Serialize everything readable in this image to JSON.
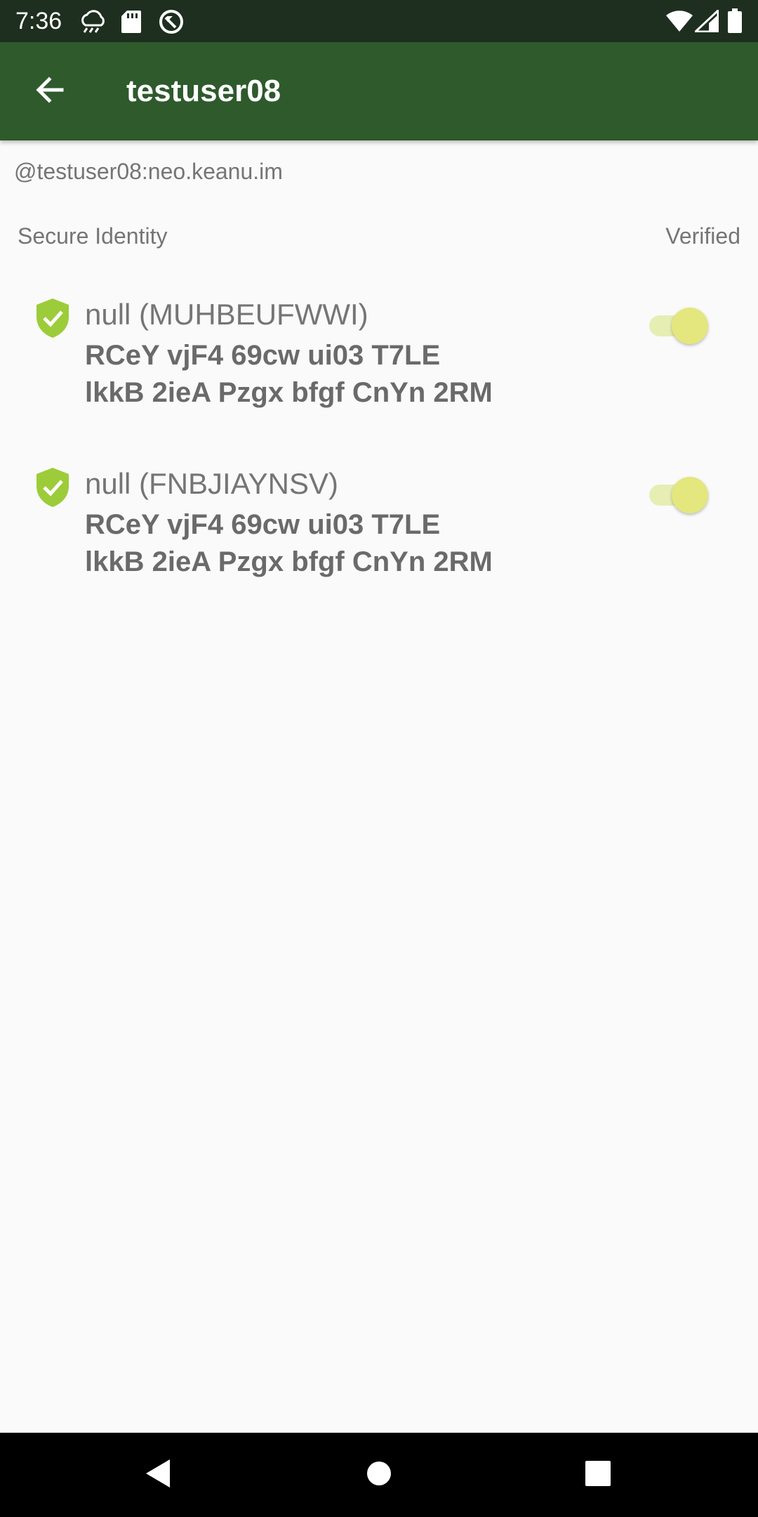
{
  "status_bar": {
    "time": "7:36",
    "icons": [
      "cloud-icon",
      "sd-card-icon",
      "sync-icon",
      "wifi-icon",
      "signal-icon",
      "battery-icon"
    ]
  },
  "app_bar": {
    "back_icon": "arrow-left-icon",
    "title": "testuser08"
  },
  "user": {
    "id": "@testuser08:neo.keanu.im"
  },
  "section": {
    "title": "Secure Identity",
    "verified_label": "Verified"
  },
  "devices": [
    {
      "name": "null (MUHBEUFWWI)",
      "fingerprint_line1": "RCeY vjF4 69cw ui03 T7LE",
      "fingerprint_line2": "lkkB 2ieA Pzgx bfgf CnYn 2RM",
      "verified": true,
      "icon": "shield-check-icon"
    },
    {
      "name": "null (FNBJIAYNSV)",
      "fingerprint_line1": "RCeY vjF4 69cw ui03 T7LE",
      "fingerprint_line2": "lkkB 2ieA Pzgx bfgf CnYn 2RM",
      "verified": true,
      "icon": "shield-check-icon"
    }
  ],
  "nav_bar": {
    "buttons": [
      "back-triangle-icon",
      "home-circle-icon",
      "recents-square-icon"
    ]
  },
  "colors": {
    "status_bar": "#1e2e1f",
    "app_bar": "#2e5a2c",
    "background": "#fafafa",
    "shield": "#9ccc3a",
    "toggle_thumb": "#e3e77d",
    "toggle_track": "#e6eeb4"
  }
}
